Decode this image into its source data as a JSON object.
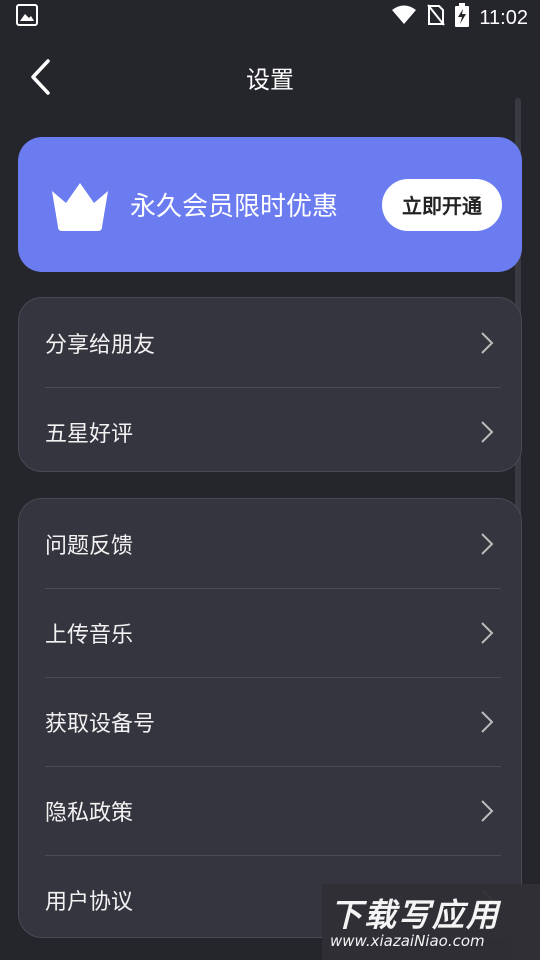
{
  "status_bar": {
    "time": "11:02"
  },
  "header": {
    "title": "设置"
  },
  "vip_banner": {
    "text": "永久会员限时优惠",
    "button_label": "立即开通",
    "color": "#6b7cf0"
  },
  "group1": [
    {
      "label": "分享给朋友"
    },
    {
      "label": "五星好评"
    }
  ],
  "group2": [
    {
      "label": "问题反馈"
    },
    {
      "label": "上传音乐"
    },
    {
      "label": "获取设备号"
    },
    {
      "label": "隐私政策"
    },
    {
      "label": "用户协议"
    }
  ],
  "watermark": {
    "title": "下载写应用",
    "url": "www.xiazaiNiao.com"
  }
}
